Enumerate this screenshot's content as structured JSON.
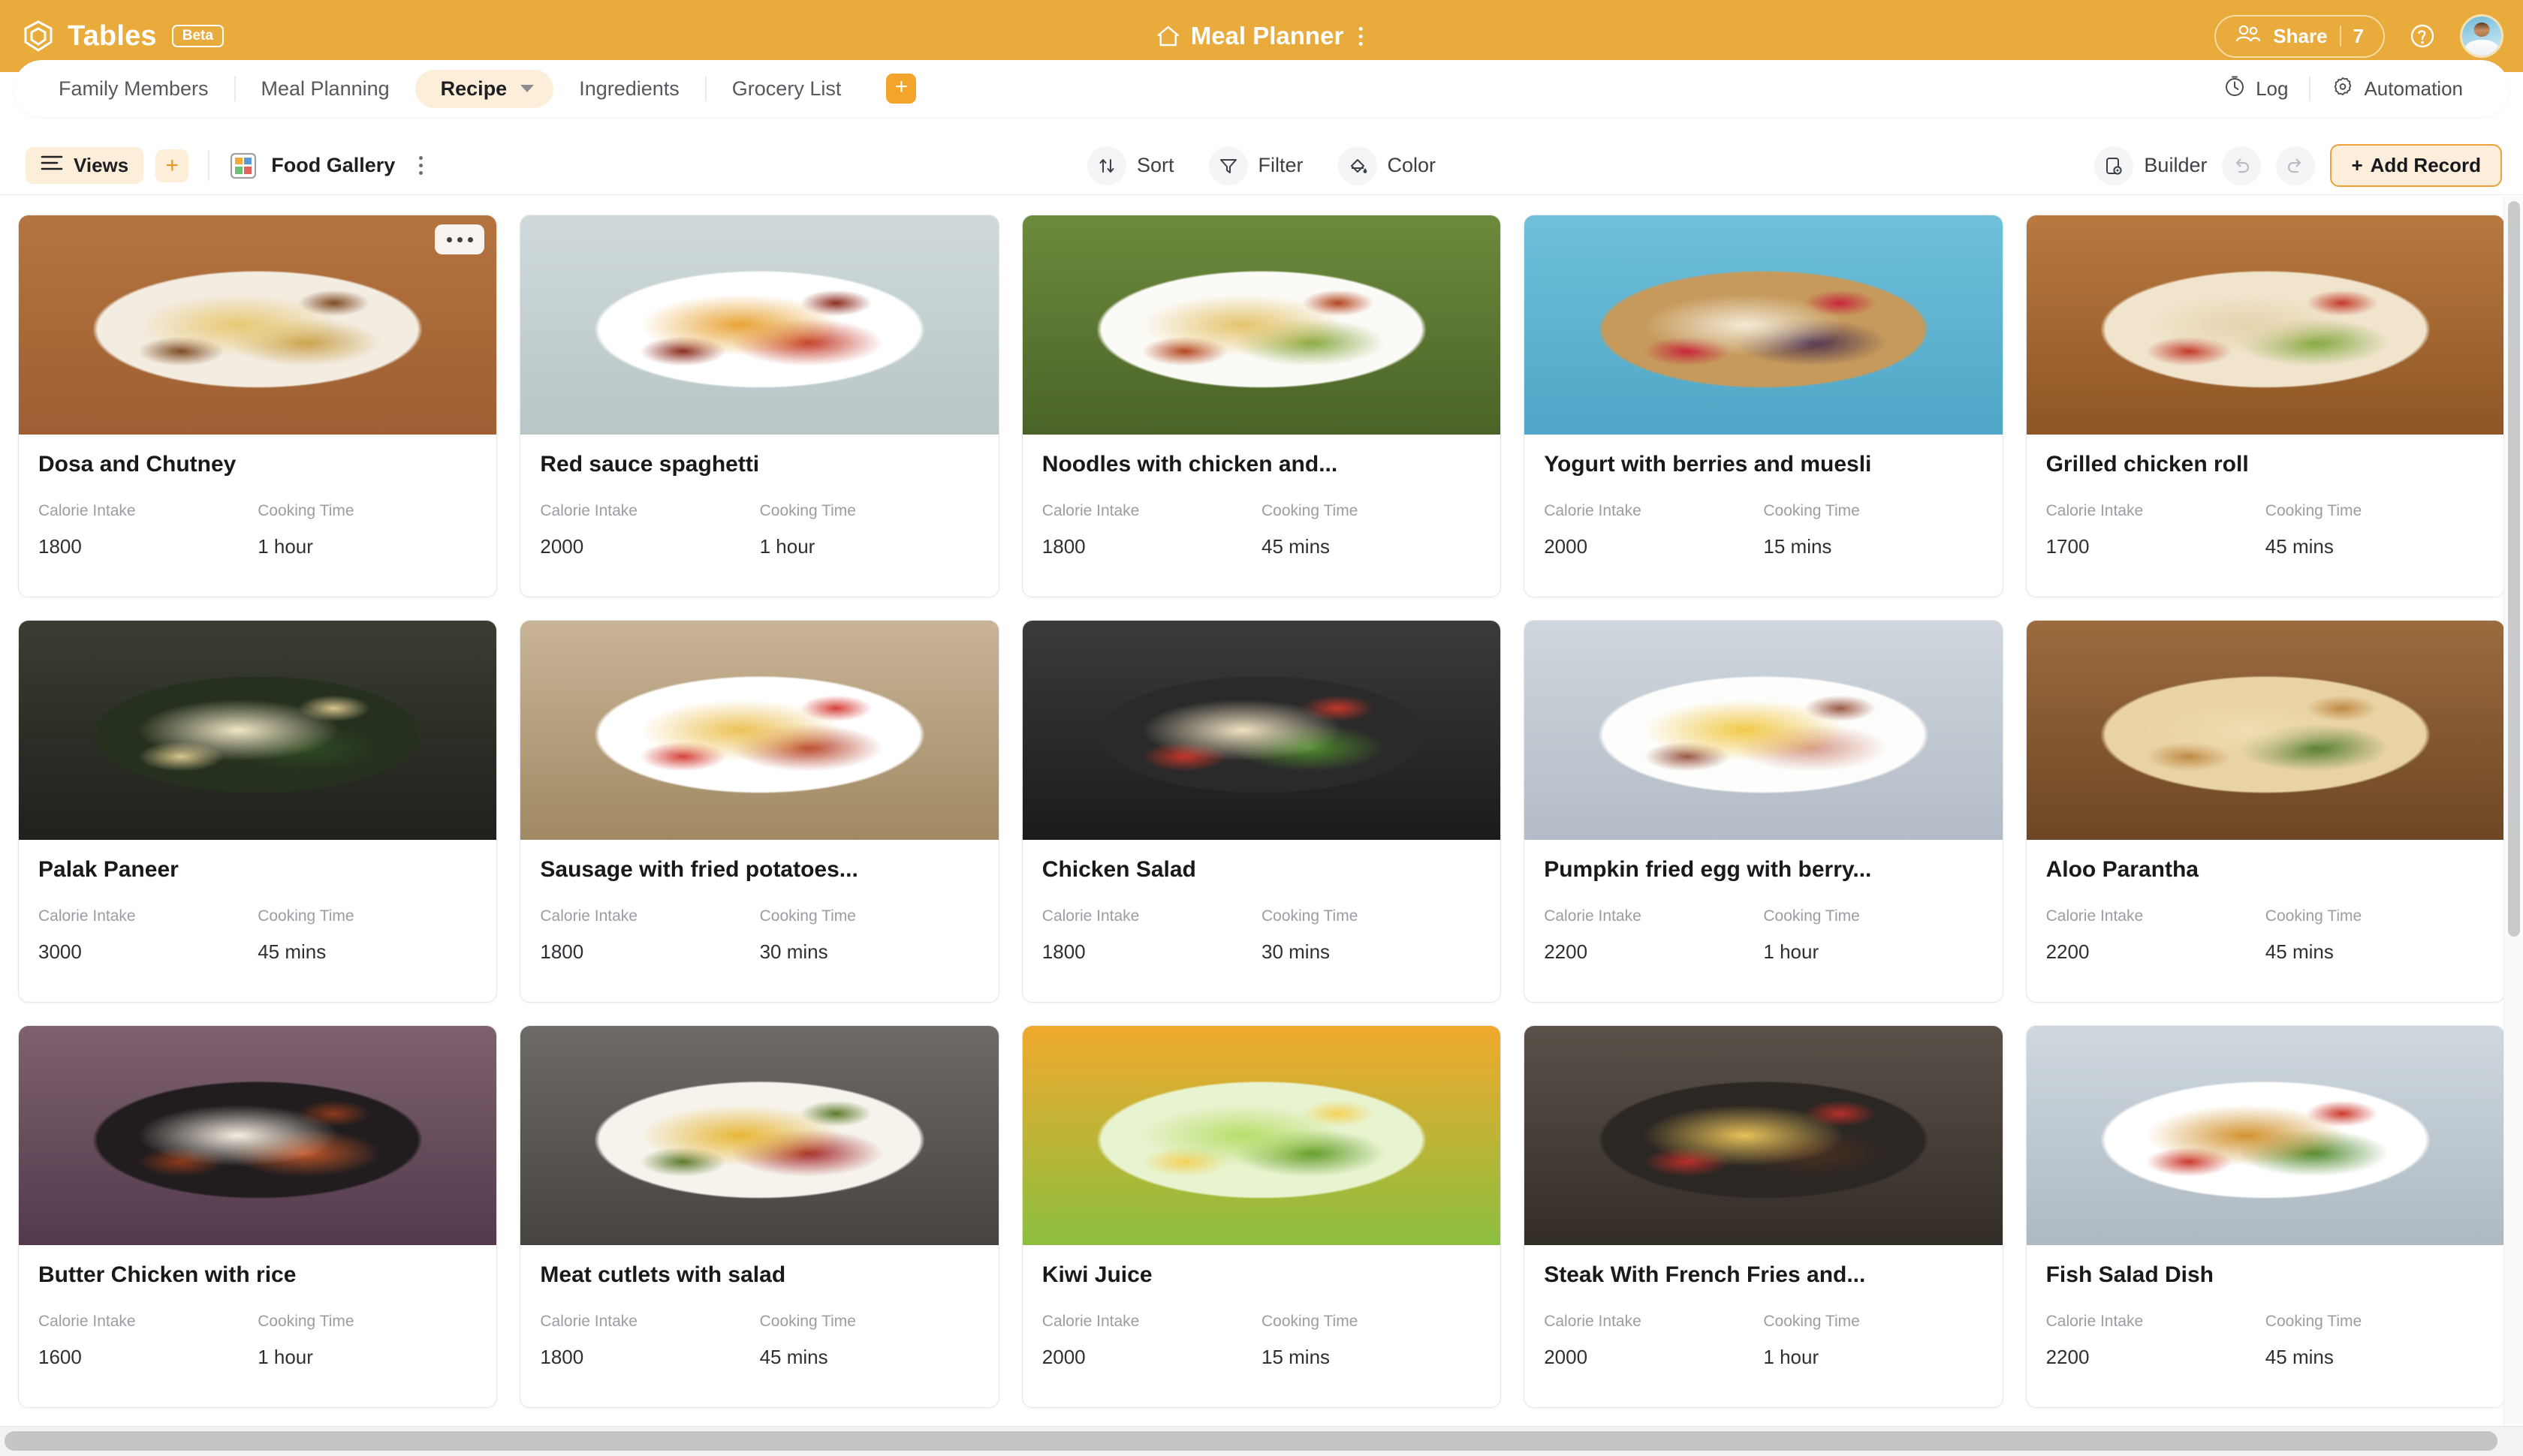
{
  "app": {
    "brand_name": "Tables",
    "beta_label": "Beta",
    "logo_icon": "tables-logo-icon"
  },
  "header": {
    "home_icon": "home-icon",
    "doc_title": "Meal Planner",
    "doc_menu_icon": "vertical-dots-icon",
    "share_label": "Share",
    "share_count": "7",
    "share_icon": "people-icon",
    "help_icon": "help-circle-icon",
    "avatar_icon": "user-avatar"
  },
  "tabs": {
    "items": [
      {
        "label": "Family Members",
        "active": false
      },
      {
        "label": "Meal Planning",
        "active": false
      },
      {
        "label": "Recipe",
        "active": true
      },
      {
        "label": "Ingredients",
        "active": false
      },
      {
        "label": "Grocery List",
        "active": false
      }
    ],
    "add_tab_label": "+",
    "right": {
      "log_label": "Log",
      "log_icon": "clock-icon",
      "automation_label": "Automation",
      "automation_icon": "gear-icon"
    }
  },
  "toolbar": {
    "views_label": "Views",
    "views_icon": "list-lines-icon",
    "add_view_label": "+",
    "current_view": "Food Gallery",
    "gallery_icon": "gallery-grid-icon",
    "view_menu_icon": "vertical-dots-icon",
    "sort_label": "Sort",
    "sort_icon": "sort-arrows-icon",
    "filter_label": "Filter",
    "filter_icon": "funnel-icon",
    "color_label": "Color",
    "color_icon": "paint-bucket-icon",
    "builder_label": "Builder",
    "builder_icon": "builder-icon",
    "undo_icon": "undo-arrow-icon",
    "redo_icon": "redo-arrow-icon",
    "add_record_label": "Add Record",
    "add_record_plus": "+"
  },
  "field_labels": {
    "calorie": "Calorie Intake",
    "cooking": "Cooking Time"
  },
  "colors": {
    "brand_orange": "#e8ab3c",
    "accent_orange": "#f3a42a",
    "active_tab_bg": "#fdeed9",
    "text_dark": "#17191c",
    "text_muted": "#9a9ea3"
  },
  "cards": [
    {
      "title": "Dosa and Chutney",
      "calories": "1800",
      "time": "1 hour",
      "more_icon": "more-dots-icon",
      "has_more": true,
      "img": {
        "bg": "linear-gradient(180deg,#b5743f 0%,#9d5f33 100%)",
        "plate": "#f3ece1",
        "food1": "#e8c873",
        "food2": "#c9a04a",
        "accent": "#7d4b24"
      }
    },
    {
      "title": "Red sauce spaghetti",
      "calories": "2000",
      "time": "1 hour",
      "more_icon": "more-dots-icon",
      "has_more": false,
      "img": {
        "bg": "linear-gradient(180deg,#cfd9da 0%,#b8c6c8 100%)",
        "plate": "#ffffff",
        "food1": "#e8a437",
        "food2": "#c33a28",
        "accent": "#8c2e20"
      }
    },
    {
      "title": "Noodles with chicken and...",
      "calories": "1800",
      "time": "45 mins",
      "more_icon": "more-dots-icon",
      "has_more": false,
      "img": {
        "bg": "linear-gradient(180deg,#6c8b3c 0%,#4b6328 100%)",
        "plate": "#fbfaf6",
        "food1": "#e5c36b",
        "food2": "#86a83e",
        "accent": "#b4461f"
      }
    },
    {
      "title": "Yogurt with berries and muesli",
      "calories": "2000",
      "time": "15 mins",
      "more_icon": "more-dots-icon",
      "has_more": false,
      "img": {
        "bg": "linear-gradient(180deg,#6fc0db 0%,#4fa6c6 100%)",
        "plate": "#c69a5c",
        "food1": "#f3ead6",
        "food2": "#4b2f4e",
        "accent": "#c6273a"
      }
    },
    {
      "title": "Grilled chicken roll",
      "calories": "1700",
      "time": "45 mins",
      "more_icon": "more-dots-icon",
      "has_more": false,
      "img": {
        "bg": "linear-gradient(180deg,#b9793f 0%,#8d5626 100%)",
        "plate": "#f0e4cd",
        "food1": "#e7d3ad",
        "food2": "#7fa63a",
        "accent": "#c23b2a"
      }
    },
    {
      "title": "Palak Paneer",
      "calories": "3000",
      "time": "45 mins",
      "more_icon": "more-dots-icon",
      "has_more": false,
      "img": {
        "bg": "linear-gradient(180deg,#3a3d32 0%,#1f211b 100%)",
        "plate": "#26301f",
        "food1": "#f0e6c6",
        "food2": "#2f4a22",
        "accent": "#d8c68e"
      }
    },
    {
      "title": "Sausage with fried potatoes...",
      "calories": "1800",
      "time": "30 mins",
      "more_icon": "more-dots-icon",
      "has_more": false,
      "img": {
        "bg": "linear-gradient(180deg,#c9b497 0%,#a08963 100%)",
        "plate": "#ffffff",
        "food1": "#edc257",
        "food2": "#b8452c",
        "accent": "#d6423a"
      }
    },
    {
      "title": "Chicken Salad",
      "calories": "1800",
      "time": "30 mins",
      "more_icon": "more-dots-icon",
      "has_more": false,
      "img": {
        "bg": "linear-gradient(180deg,#3b3b3b 0%,#1b1b1b 100%)",
        "plate": "#2a2a2a",
        "food1": "#efe2c1",
        "food2": "#4f8a2e",
        "accent": "#c4362a"
      }
    },
    {
      "title": "Pumpkin fried egg with berry...",
      "calories": "2200",
      "time": "1 hour",
      "more_icon": "more-dots-icon",
      "has_more": false,
      "img": {
        "bg": "linear-gradient(180deg,#cfd6dd 0%,#b3bcc6 100%)",
        "plate": "#fdfdfb",
        "food1": "#f2c94c",
        "food2": "#d59a8b",
        "accent": "#9c5a46"
      }
    },
    {
      "title": "Aloo Parantha",
      "calories": "2200",
      "time": "45 mins",
      "more_icon": "more-dots-icon",
      "has_more": false,
      "img": {
        "bg": "linear-gradient(180deg,#9c6b3e 0%,#6d4724 100%)",
        "plate": "#e9d3a5",
        "food1": "#f0dcb0",
        "food2": "#4e7a2a",
        "accent": "#c08a45"
      }
    },
    {
      "title": "Butter Chicken with rice",
      "calories": "1600",
      "time": "1 hour",
      "more_icon": "more-dots-icon",
      "has_more": false,
      "img": {
        "bg": "linear-gradient(180deg,#7e6170 0%,#533a4a 100%)",
        "plate": "#211d1f",
        "food1": "#f5efe2",
        "food2": "#c0562a",
        "accent": "#8d3a1c"
      }
    },
    {
      "title": "Meat cutlets with salad",
      "calories": "1800",
      "time": "45 mins",
      "more_icon": "more-dots-icon",
      "has_more": false,
      "img": {
        "bg": "linear-gradient(180deg,#6e6a66 0%,#47443f 100%)",
        "plate": "#f6f3ec",
        "food1": "#e7b737",
        "food2": "#a4282a",
        "accent": "#5d7a2c"
      }
    },
    {
      "title": "Kiwi Juice",
      "calories": "2000",
      "time": "15 mins",
      "more_icon": "more-dots-icon",
      "has_more": false,
      "img": {
        "bg": "linear-gradient(180deg,#f0a92e 0%,#8cbf3f 100%)",
        "plate": "#e8f3cf",
        "food1": "#b9dd6a",
        "food2": "#5e9a24",
        "accent": "#f3d25a"
      }
    },
    {
      "title": "Steak With French Fries and...",
      "calories": "2000",
      "time": "1 hour",
      "more_icon": "more-dots-icon",
      "has_more": false,
      "img": {
        "bg": "linear-gradient(180deg,#5a5149 0%,#332d27 100%)",
        "plate": "#2b2723",
        "food1": "#e8c15a",
        "food2": "#4a2f22",
        "accent": "#b72f2a"
      }
    },
    {
      "title": "Fish Salad Dish",
      "calories": "2200",
      "time": "45 mins",
      "more_icon": "more-dots-icon",
      "has_more": false,
      "img": {
        "bg": "linear-gradient(180deg,#cfd8df 0%,#aeb9c2 100%)",
        "plate": "#ffffff",
        "food1": "#d1932f",
        "food2": "#4f8a2e",
        "accent": "#cc3a2e"
      }
    }
  ]
}
